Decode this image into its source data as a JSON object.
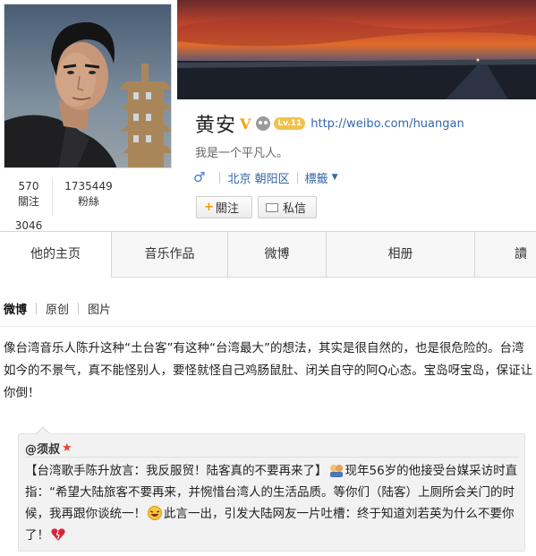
{
  "profile": {
    "name": "黄安",
    "verified_mark": "V",
    "level_badge": "Lv.11",
    "url": "http://weibo.com/huangan",
    "bio": "我是一个平凡人。",
    "gender_icon": "male-icon",
    "location": "北京 朝阳区",
    "tags_label": "標籤",
    "follow_label": "關注",
    "follow_plus": "+",
    "message_label": "私信"
  },
  "stats": {
    "following_count": "570",
    "following_label": "關注",
    "followers_count": "1735449",
    "followers_label": "粉絲",
    "posts_count": "3046"
  },
  "tabs": [
    {
      "label": "他的主页",
      "active": true
    },
    {
      "label": "音乐作品",
      "active": false
    },
    {
      "label": "微博",
      "active": false
    },
    {
      "label": "相册",
      "active": false
    },
    {
      "label": "讀",
      "active": false
    }
  ],
  "subtabs": [
    {
      "label": "微博",
      "active": true
    },
    {
      "label": "原创",
      "active": false
    },
    {
      "label": "图片",
      "active": false
    }
  ],
  "post": {
    "text": "像台湾音乐人陈升这种“土台客”有这种“台湾最大”的想法，其实是很自然的，也是很危险的。台湾如今的不景气，真不能怪别人，要怪就怪自己鸡肠鼠肚、闭关自守的阿Q心态。宝岛呀宝岛，保证让你倒！"
  },
  "quote": {
    "author": "@须叔",
    "text_1": "【台湾歌手陈升放言：我反服贸！陆客真的不要再来了】",
    "text_2": "现年56岁的他接受台媒采访时直指：“希望大陆旅客不要再来，并惋惜台湾人的生活品质。等你们（陆客）上厕所会关门的时候，我再跟你谈统一！",
    "text_3": "此言一出，引发大陆网友一片吐槽：终于知道刘若英为什么不要你了！"
  },
  "colors": {
    "link": "#3366aa",
    "level_badge": "#f0c24a",
    "verified": "#f5a20a",
    "star": "#e8412c"
  }
}
